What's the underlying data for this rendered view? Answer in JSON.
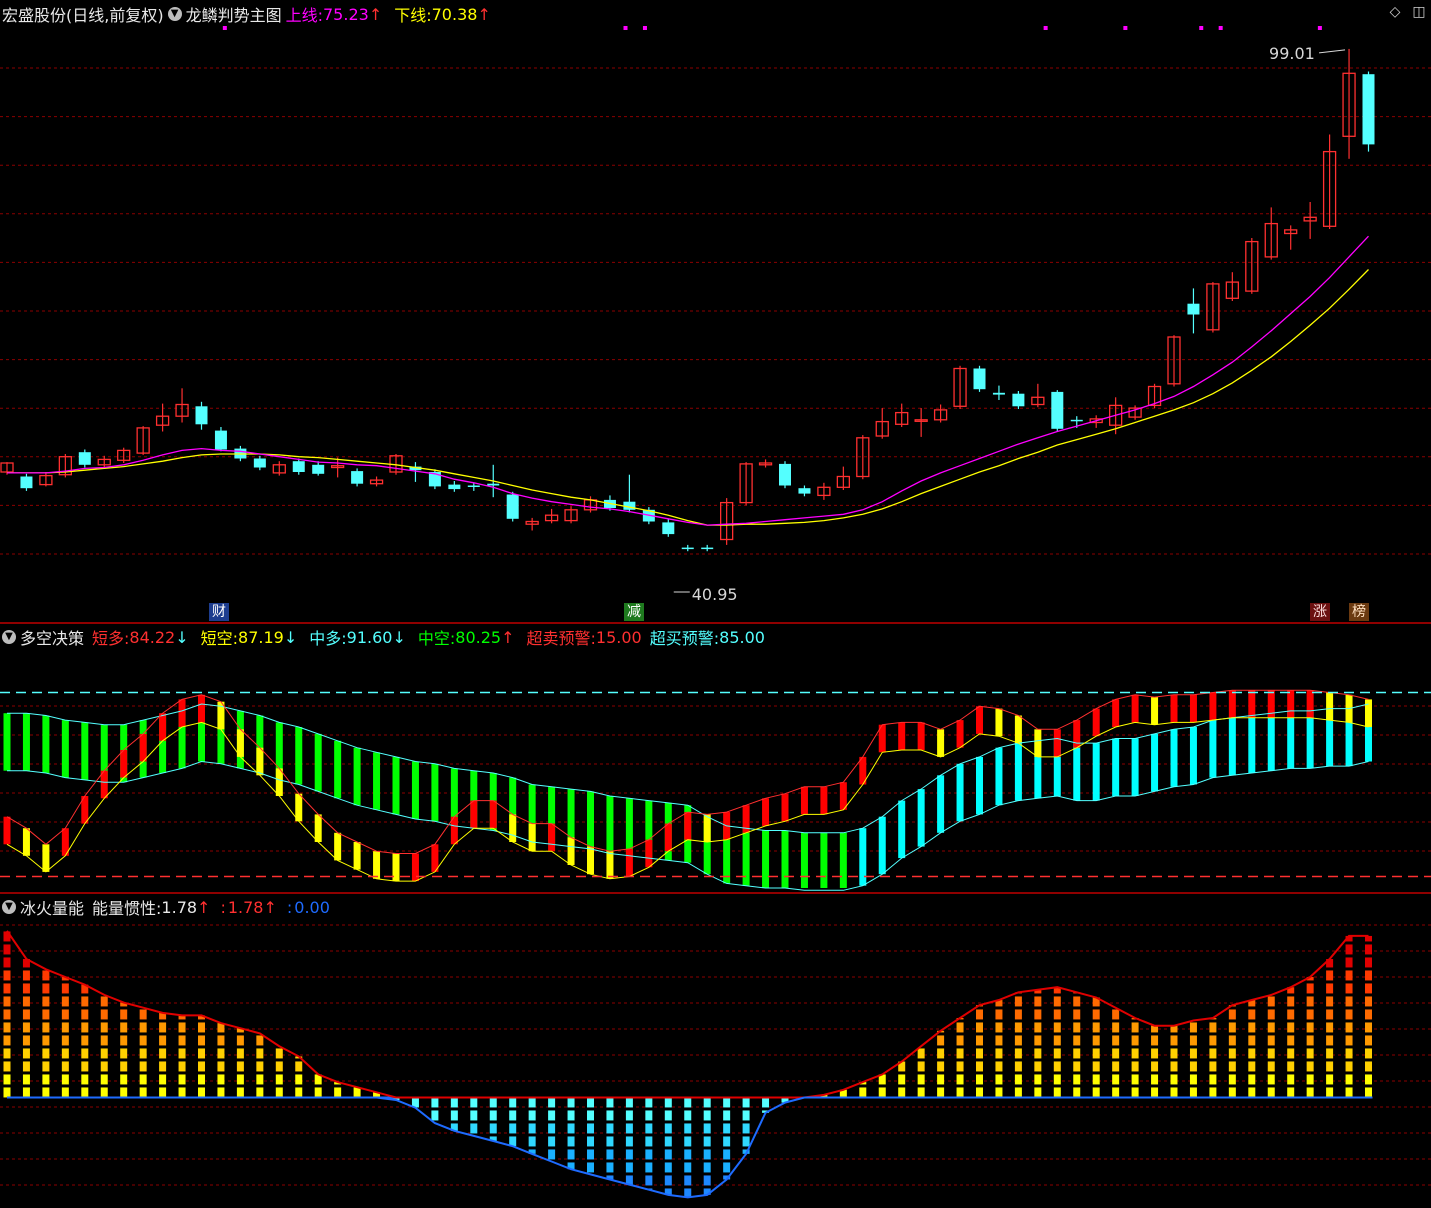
{
  "main_header": {
    "stock": "宏盛股份(日线,前复权)",
    "indicator": "龙鳞判势主图",
    "upper_label": "上线:",
    "upper_value": "75.23",
    "lower_label": "下线:",
    "lower_value": "70.38",
    "arrow_up": "↑",
    "arrow_down": "↓"
  },
  "panel2_header": {
    "title": "多空决策",
    "short_long_label": "短多:",
    "short_long_value": "84.22",
    "short_short_label": "短空:",
    "short_short_value": "87.19",
    "mid_long_label": "中多:",
    "mid_long_value": "91.60",
    "mid_short_label": "中空:",
    "mid_short_value": "80.25",
    "oversold_label": "超卖预警:",
    "oversold_value": "15.00",
    "overbought_label": "超买预警:",
    "overbought_value": "85.00"
  },
  "panel3_header": {
    "title": "冰火量能",
    "energy_label": "能量惯性:",
    "energy_value": "1.78",
    "v2_prefix": ":",
    "v2_value": "1.78",
    "v3_prefix": ":",
    "v3_value": "0.00"
  },
  "events": {
    "cai": "财",
    "jian": "减",
    "zhang": "涨",
    "bang": "榜"
  },
  "annotations": {
    "high_price": "99.01",
    "low_price": "40.95"
  },
  "colors": {
    "up": "#ff3030",
    "down": "#54ffff",
    "ma_upper": "#ff00ff",
    "ma_lower": "#ffff00",
    "grid": "#8b0000",
    "green": "#00ff00",
    "cyan": "#00ffff",
    "yellow": "#ffff00",
    "red": "#ff0000",
    "blue": "#1e6bff"
  },
  "chart_data": [
    {
      "type": "candlestick",
      "title": "龙鳞判势主图",
      "ylim": [
        38,
        102
      ],
      "candles": [
        [
          52.0,
          53.0,
          51.7,
          53.1
        ],
        [
          51.5,
          50.2,
          49.9,
          51.8
        ],
        [
          50.6,
          51.6,
          50.4,
          52.0
        ],
        [
          51.7,
          53.7,
          51.4,
          54.0
        ],
        [
          54.2,
          52.8,
          52.5,
          54.5
        ],
        [
          52.8,
          53.4,
          52.5,
          53.8
        ],
        [
          53.3,
          54.4,
          53.0,
          54.7
        ],
        [
          54.1,
          56.9,
          53.9,
          57.1
        ],
        [
          57.2,
          58.2,
          56.5,
          59.6
        ],
        [
          58.2,
          59.5,
          57.5,
          61.3
        ],
        [
          59.3,
          57.3,
          56.7,
          59.8
        ],
        [
          56.6,
          54.5,
          54.3,
          57.0
        ],
        [
          54.6,
          53.5,
          53.2,
          54.9
        ],
        [
          53.5,
          52.5,
          52.2,
          53.8
        ],
        [
          51.9,
          52.8,
          51.6,
          53.2
        ],
        [
          53.2,
          52.0,
          51.7,
          53.5
        ],
        [
          52.8,
          51.8,
          51.6,
          53.2
        ],
        [
          52.5,
          52.7,
          51.4,
          53.6
        ],
        [
          52.1,
          50.7,
          50.4,
          52.4
        ],
        [
          50.7,
          51.1,
          50.4,
          51.5
        ],
        [
          52.0,
          53.8,
          51.7,
          54.0
        ],
        [
          52.6,
          52.2,
          50.9,
          53.1
        ],
        [
          52.0,
          50.4,
          50.1,
          52.3
        ],
        [
          50.6,
          50.1,
          49.8,
          51.0
        ],
        [
          50.5,
          50.4,
          49.9,
          50.8
        ],
        [
          50.7,
          50.5,
          49.2,
          52.8
        ],
        [
          49.5,
          46.8,
          46.5,
          49.8
        ],
        [
          46.2,
          46.5,
          45.5,
          46.9
        ],
        [
          46.6,
          47.2,
          46.3,
          47.9
        ],
        [
          46.6,
          47.8,
          46.3,
          48.2
        ],
        [
          47.8,
          48.9,
          47.5,
          49.3
        ],
        [
          48.9,
          48.0,
          47.7,
          49.4
        ],
        [
          48.7,
          47.8,
          47.5,
          51.7
        ],
        [
          47.8,
          46.5,
          46.2,
          48.1
        ],
        [
          46.4,
          45.1,
          44.8,
          46.8
        ],
        [
          43.6,
          43.5,
          43.2,
          43.9
        ],
        [
          43.6,
          43.5,
          43.2,
          43.9
        ],
        [
          44.5,
          48.6,
          43.9,
          49.1
        ],
        [
          48.6,
          52.9,
          48.3,
          53.1
        ],
        [
          52.8,
          53.0,
          52.5,
          53.4
        ],
        [
          52.9,
          50.5,
          50.2,
          53.2
        ],
        [
          50.2,
          49.6,
          49.3,
          50.5
        ],
        [
          49.4,
          50.3,
          48.9,
          50.8
        ],
        [
          50.3,
          51.5,
          50.0,
          52.6
        ],
        [
          51.5,
          55.8,
          51.2,
          56.1
        ],
        [
          56.0,
          57.6,
          55.7,
          59.1
        ],
        [
          57.3,
          58.6,
          57.0,
          59.6
        ],
        [
          57.7,
          57.8,
          55.9,
          59.1
        ],
        [
          57.8,
          58.9,
          57.5,
          59.5
        ],
        [
          59.3,
          63.5,
          59.0,
          63.8
        ],
        [
          63.5,
          61.2,
          60.9,
          63.8
        ],
        [
          60.8,
          60.6,
          60.0,
          61.6
        ],
        [
          60.7,
          59.3,
          59.0,
          61.0
        ],
        [
          59.5,
          60.3,
          59.2,
          61.8
        ],
        [
          60.9,
          56.8,
          56.5,
          61.1
        ],
        [
          57.8,
          57.7,
          56.9,
          58.2
        ],
        [
          57.5,
          57.9,
          56.9,
          58.3
        ],
        [
          57.2,
          59.4,
          56.2,
          60.3
        ],
        [
          58.1,
          59.1,
          57.8,
          59.4
        ],
        [
          59.4,
          61.5,
          59.1,
          61.8
        ],
        [
          61.8,
          67.0,
          61.5,
          67.2
        ],
        [
          70.7,
          69.5,
          67.4,
          72.4
        ],
        [
          67.8,
          72.9,
          67.5,
          73.1
        ],
        [
          71.3,
          73.1,
          71.0,
          74.2
        ],
        [
          72.1,
          77.6,
          71.8,
          78.0
        ],
        [
          75.9,
          79.6,
          75.6,
          81.4
        ],
        [
          78.5,
          78.9,
          76.7,
          79.4
        ],
        [
          79.9,
          80.3,
          77.9,
          82.0
        ],
        [
          79.3,
          87.6,
          79.0,
          89.5
        ],
        [
          89.3,
          96.3,
          86.8,
          99.01
        ],
        [
          96.2,
          88.4,
          87.6,
          96.5
        ]
      ],
      "ma_upper": [
        51.9,
        51.9,
        51.9,
        52.1,
        52.4,
        52.5,
        52.8,
        53.3,
        53.9,
        54.4,
        54.6,
        54.4,
        54.3,
        54.0,
        53.7,
        53.4,
        53.1,
        53.0,
        52.8,
        52.7,
        52.4,
        52.1,
        51.8,
        51.2,
        50.8,
        50.3,
        49.6,
        49.1,
        48.7,
        48.4,
        48.1,
        47.9,
        47.6,
        47.2,
        46.8,
        46.4,
        46.1,
        46.2,
        46.3,
        46.5,
        46.7,
        46.9,
        47.1,
        47.3,
        47.8,
        48.7,
        49.9,
        51.0,
        51.9,
        52.7,
        53.5,
        54.3,
        55.1,
        55.8,
        56.5,
        57.1,
        57.7,
        58.3,
        58.9,
        59.6,
        60.4,
        61.5,
        62.8,
        64.2,
        65.9,
        67.7,
        69.6,
        71.5,
        73.6,
        75.9,
        78.2
      ],
      "ma_lower": [
        51.9,
        51.9,
        51.9,
        52.0,
        52.2,
        52.4,
        52.6,
        52.9,
        53.2,
        53.6,
        53.9,
        54.0,
        54.0,
        54.0,
        53.9,
        53.7,
        53.6,
        53.4,
        53.2,
        53.0,
        52.8,
        52.5,
        52.2,
        51.8,
        51.4,
        51.0,
        50.5,
        50.0,
        49.6,
        49.2,
        48.9,
        48.5,
        48.1,
        47.7,
        47.2,
        46.6,
        46.1,
        46.1,
        46.2,
        46.2,
        46.3,
        46.4,
        46.6,
        46.9,
        47.3,
        47.9,
        48.7,
        49.6,
        50.4,
        51.2,
        52.0,
        52.7,
        53.5,
        54.2,
        55.0,
        55.6,
        56.2,
        56.8,
        57.5,
        58.2,
        58.9,
        59.7,
        60.7,
        61.9,
        63.3,
        64.8,
        66.5,
        68.3,
        70.2,
        72.3,
        74.5
      ]
    },
    {
      "type": "bar",
      "title": "多空决策",
      "ylim": [
        0,
        100
      ],
      "thresholds": {
        "oversold": 15.0,
        "overbought": 85.0
      },
      "short": [
        31,
        26,
        19,
        26,
        40,
        51,
        60,
        67,
        76,
        82,
        84,
        81,
        69,
        61,
        52,
        41,
        32,
        24,
        20,
        16,
        15,
        15,
        19,
        31,
        38,
        38,
        32,
        28,
        28,
        22,
        18,
        16,
        17,
        21,
        28,
        33,
        32,
        33,
        36,
        39,
        41,
        44,
        44,
        46,
        57,
        71,
        72,
        72,
        69,
        73,
        79,
        78,
        75,
        69,
        69,
        73,
        78,
        82,
        84,
        83,
        84,
        84,
        85,
        86,
        86,
        86,
        86,
        86,
        85,
        84,
        82
      ],
      "mid": [
        76,
        76,
        75,
        73,
        72,
        71,
        71,
        73,
        75,
        77,
        80,
        79,
        77,
        75,
        72,
        70,
        67,
        64,
        61,
        59,
        57,
        55,
        54,
        52,
        51,
        50,
        48,
        45,
        44,
        43,
        42,
        40,
        39,
        38,
        37,
        36,
        31,
        27,
        26,
        25,
        25,
        24,
        24,
        24,
        26,
        31,
        38,
        43,
        49,
        54,
        57,
        61,
        63,
        64,
        65,
        63,
        63,
        65,
        65,
        67,
        69,
        70,
        73,
        74,
        75,
        76,
        77,
        77,
        78,
        78,
        80
      ]
    },
    {
      "type": "bar",
      "title": "冰火量能",
      "ylim": [
        -40,
        70
      ],
      "values": [
        65,
        54,
        50,
        47,
        44,
        40,
        37,
        35,
        33,
        32,
        32,
        29,
        27,
        25,
        20,
        16,
        9,
        6,
        4,
        2,
        -1,
        -4,
        -10,
        -13,
        -15,
        -17,
        -19,
        -22,
        -25,
        -28,
        -30,
        -32,
        -34,
        -36,
        -38,
        -39,
        -38,
        -32,
        -22,
        -6,
        -2,
        0,
        1,
        3,
        6,
        9,
        14,
        20,
        26,
        31,
        36,
        38,
        41,
        42,
        43,
        41,
        39,
        35,
        31,
        28,
        28,
        30,
        31,
        36,
        38,
        40,
        43,
        47,
        54,
        63,
        63
      ]
    }
  ]
}
